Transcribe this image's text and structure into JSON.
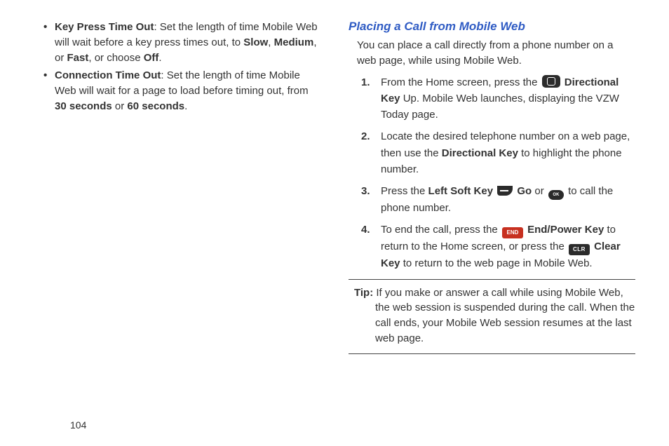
{
  "left": {
    "bullets": [
      {
        "title": "Key Press Time Out",
        "afterTitle": ": Set the length of time Mobile Web will wait before a key press times out, to ",
        "b1": "Slow",
        "sep1": ", ",
        "b2": "Medium",
        "sep2": ", or ",
        "b3": "Fast",
        "sep3": ", or choose ",
        "b4": "Off",
        "sep4": "."
      },
      {
        "title": "Connection Time Out",
        "afterTitle": ": Set the length of time Mobile Web will wait for a page to load before timing out, from ",
        "b1": "30 seconds",
        "sep1": " or ",
        "b2": "60 seconds",
        "sep2": ".",
        "b3": "",
        "sep3": "",
        "b4": "",
        "sep4": ""
      }
    ]
  },
  "right": {
    "heading": "Placing a Call from Mobile Web",
    "intro": "You can place a call directly from a phone number on a web page, while using Mobile Web.",
    "steps": {
      "s1a": "From the Home screen, press the ",
      "s1b": " Directional Key",
      "s1c": " Up. Mobile Web launches, displaying the VZW Today page.",
      "s2a": "Locate the desired telephone number on a web page, then use the ",
      "s2b": "Directional Key",
      "s2c": " to highlight the phone number.",
      "s3a": "Press the ",
      "s3b": "Left Soft Key",
      "s3c": " Go",
      "s3d": " or ",
      "s3e": " to call the phone number.",
      "s4a": "To end the call, press the ",
      "s4b": " End/Power Key",
      "s4c": " to return to the Home screen, or press the ",
      "s4d": " Clear Key",
      "s4e": " to return to the web page in Mobile Web."
    },
    "tipLabel": "Tip:",
    "tipText": " If you make or answer a call while using Mobile Web, the web session is suspended during the call. When the call ends, your Mobile Web session resumes at the last web page."
  },
  "icons": {
    "ok": "OK",
    "end": "END",
    "clr": "CLR"
  },
  "pageNumber": "104"
}
